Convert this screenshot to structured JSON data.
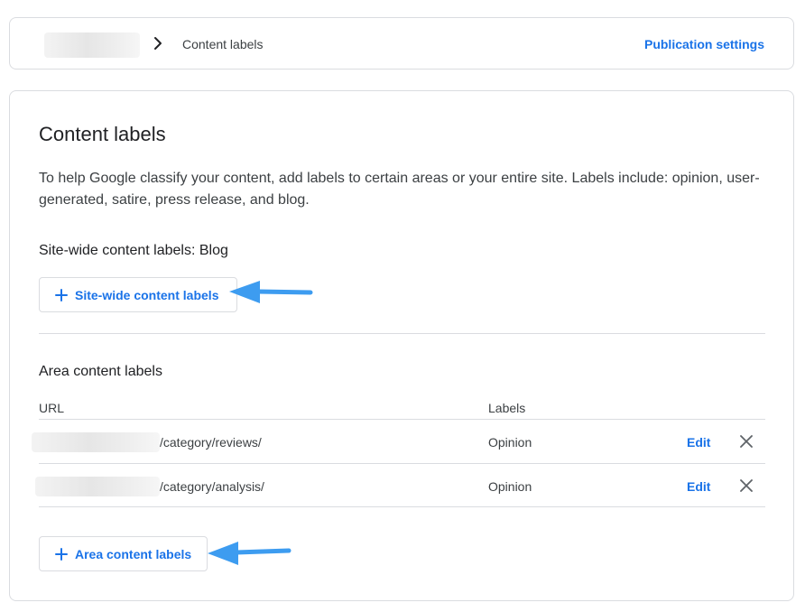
{
  "breadcrumb": {
    "current": "Content labels",
    "publication_settings": "Publication settings"
  },
  "content_labels": {
    "title": "Content labels",
    "description": "To help Google classify your content, add labels to certain areas or your entire site. Labels include: opinion, user-generated, satire, press release, and blog.",
    "sitewide": {
      "heading": "Site-wide content labels: Blog",
      "button_label": "Site-wide content labels"
    },
    "area": {
      "heading": "Area content labels",
      "columns": [
        "URL",
        "Labels"
      ],
      "rows": [
        {
          "path": "/category/reviews/",
          "label": "Opinion",
          "edit": "Edit"
        },
        {
          "path": "/category/analysis/",
          "label": "Opinion",
          "edit": "Edit"
        }
      ],
      "button_label": "Area content labels"
    }
  },
  "colors": {
    "accent": "#1a73e8",
    "annotation_arrow": "#3d9cf0",
    "border": "#dadce0"
  },
  "icons": {
    "breadcrumb_separator": "chevron-right-icon",
    "add": "plus-icon",
    "remove": "close-icon",
    "annotation": "arrow-left-icon"
  }
}
